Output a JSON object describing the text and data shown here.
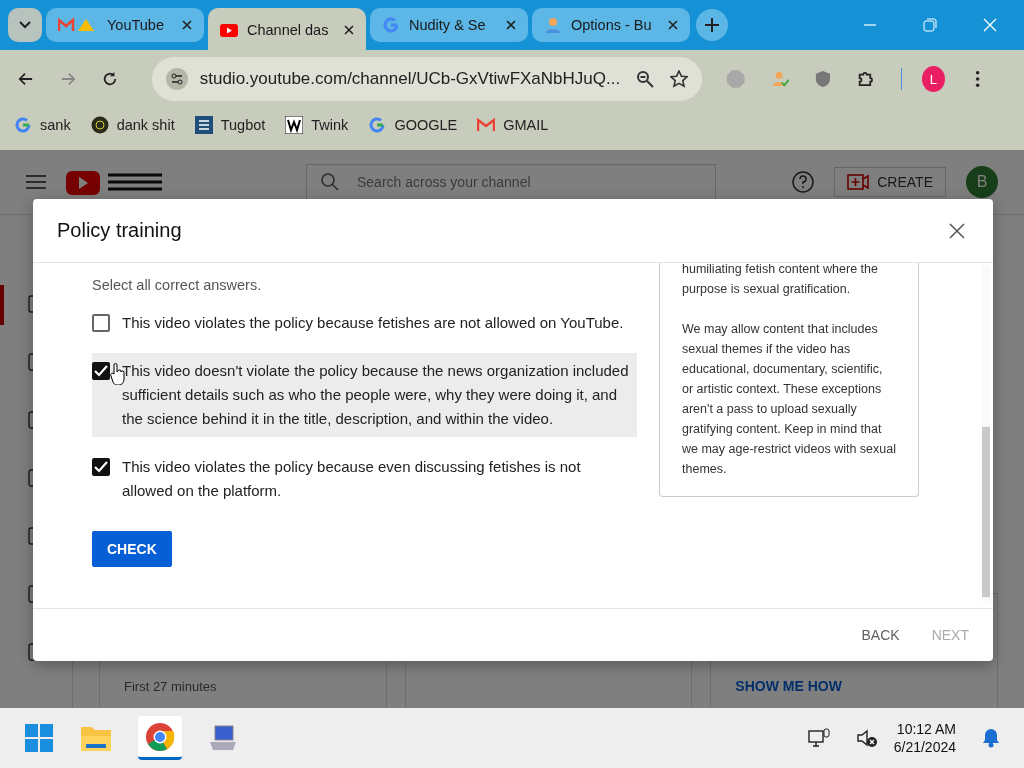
{
  "browser": {
    "tabs": [
      {
        "label": "YouTube",
        "kind": "gmail-drive",
        "selected": false
      },
      {
        "label": "Channel das",
        "kind": "youtube",
        "selected": true
      },
      {
        "label": "Nudity & Se",
        "kind": "google",
        "selected": false
      },
      {
        "label": "Options - Bu",
        "kind": "person",
        "selected": false
      }
    ],
    "address": "studio.youtube.com/channel/UCb-GxVtiwFXaNbHJuQ...",
    "profile_letter": "L",
    "bookmarks": [
      {
        "label": "sank",
        "kind": "google"
      },
      {
        "label": "dank shit",
        "kind": "circle"
      },
      {
        "label": "Tugbot",
        "kind": "square"
      },
      {
        "label": "Twink",
        "kind": "w"
      },
      {
        "label": "GOOGLE",
        "kind": "google"
      },
      {
        "label": "GMAIL",
        "kind": "gmail"
      }
    ]
  },
  "studio": {
    "search_placeholder": "Search across your channel",
    "create": "CREATE",
    "avatar_letter": "B",
    "bottom_text": "First 27 minutes",
    "bottom_link": "SHOW ME HOW"
  },
  "dialog": {
    "title": "Policy training",
    "instruction": "Select all correct answers.",
    "options": [
      {
        "text": "This video violates the policy because fetishes are not allowed on YouTube.",
        "checked": false,
        "highlighted": false
      },
      {
        "text": "This video doesn't violate the policy because the news organization included sufficient details such as who the people were, why they were doing it, and the science behind it in the title, description, and within the video.",
        "checked": true,
        "highlighted": true
      },
      {
        "text": "This video violates the policy because even discussing fetishes is not allowed on the platform.",
        "checked": true,
        "highlighted": false
      }
    ],
    "check_button": "CHECK",
    "explanation": [
      "humiliating fetish content where the purpose is sexual gratification.",
      "We may allow content that includes sexual themes if the video has educational, documentary, scientific, or artistic context. These exceptions aren't a pass to upload sexually gratifying content. Keep in mind that we may age-restrict videos with sexual themes."
    ],
    "buttons": [
      {
        "label": "BACK",
        "disabled": false
      },
      {
        "label": "NEXT",
        "disabled": true
      }
    ]
  },
  "taskbar": {
    "time": "10:12 AM",
    "date": "6/21/2024"
  }
}
